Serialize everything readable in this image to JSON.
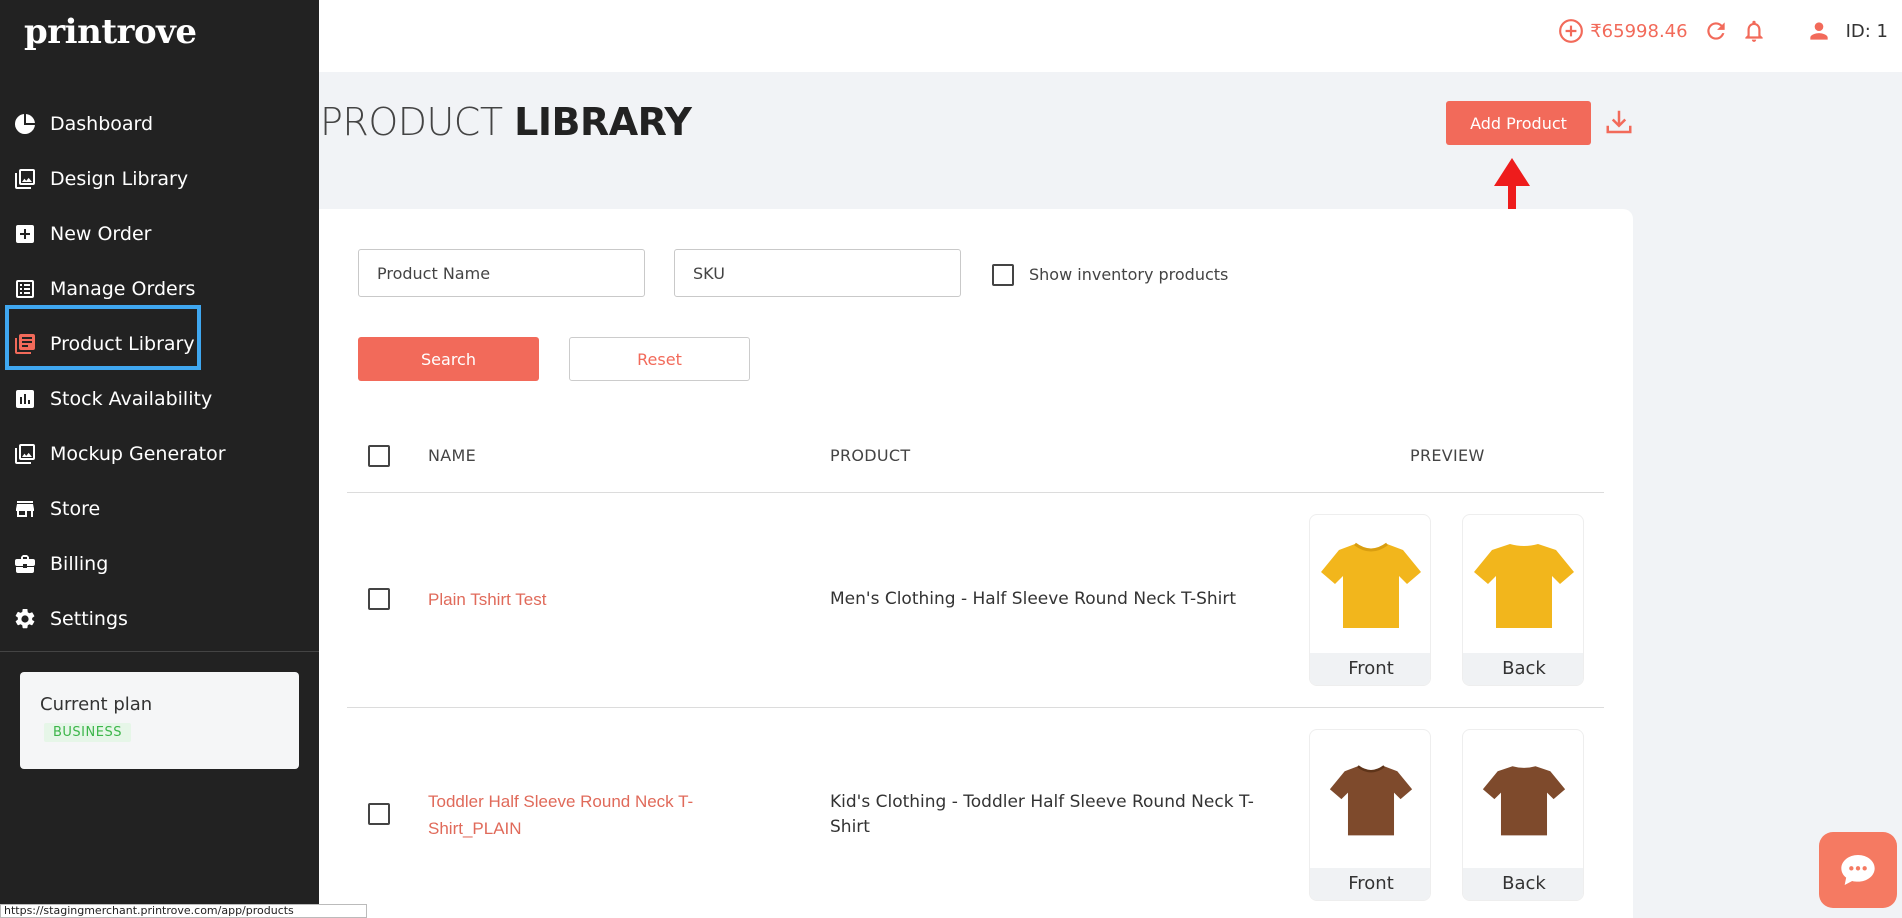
{
  "brand": {
    "logo": "printrove"
  },
  "sidebar": {
    "items": [
      {
        "label": "Dashboard",
        "icon": "dashboard-icon"
      },
      {
        "label": "Design Library",
        "icon": "image-icon"
      },
      {
        "label": "New Order",
        "icon": "plus-square-icon"
      },
      {
        "label": "Manage Orders",
        "icon": "list-icon"
      },
      {
        "label": "Product Library",
        "icon": "book-icon"
      },
      {
        "label": "Stock Availability",
        "icon": "bar-chart-icon"
      },
      {
        "label": "Mockup Generator",
        "icon": "image-icon"
      },
      {
        "label": "Store",
        "icon": "store-icon"
      },
      {
        "label": "Billing",
        "icon": "briefcase-icon"
      },
      {
        "label": "Settings",
        "icon": "gear-icon"
      }
    ],
    "active_index": 4,
    "plan": {
      "title": "Current plan",
      "badge": "BUSINESS"
    }
  },
  "topbar": {
    "balance": "₹65998.46",
    "user_id": "ID: 1"
  },
  "page": {
    "title_light": "PRODUCT",
    "title_bold": "LIBRARY",
    "add_button": "Add Product"
  },
  "filters": {
    "name_placeholder": "Product Name",
    "sku_placeholder": "SKU",
    "inventory_label": "Show inventory products",
    "search_button": "Search",
    "reset_button": "Reset"
  },
  "table": {
    "columns": {
      "name": "NAME",
      "product": "PRODUCT",
      "preview": "PREVIEW"
    },
    "rows": [
      {
        "name": "Plain Tshirt Test",
        "product": "Men's Clothing - Half Sleeve Round Neck T-Shirt",
        "front_label": "Front",
        "back_label": "Back",
        "shirt_color": "#f2b61c"
      },
      {
        "name_line1": "Toddler Half Sleeve Round Neck T-",
        "name_line2": "Shirt_PLAIN",
        "product_line1": "Kid's Clothing - Toddler Half Sleeve Round Neck T-",
        "product_line2": "Shirt",
        "front_label": "Front",
        "back_label": "Back",
        "shirt_color": "#7e4a2c"
      }
    ]
  },
  "status_url": "https://stagingmerchant.printrove.com/app/products",
  "colors": {
    "accent": "#f26a5a",
    "sidebar_bg": "#222222",
    "highlight": "#3fa7f0"
  }
}
